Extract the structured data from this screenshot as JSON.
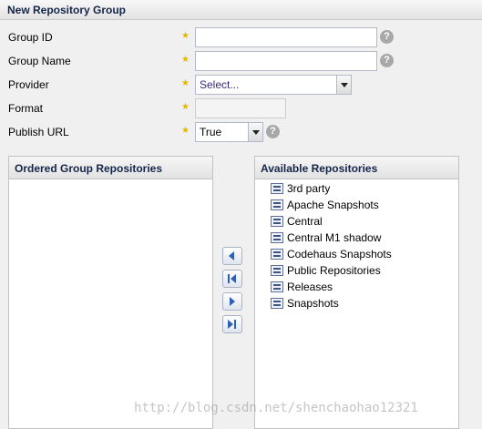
{
  "window": {
    "title": "New Repository Group"
  },
  "form": {
    "group_id": {
      "label": "Group ID",
      "value": ""
    },
    "group_name": {
      "label": "Group Name",
      "value": ""
    },
    "provider": {
      "label": "Provider",
      "placeholder": "Select..."
    },
    "format": {
      "label": "Format",
      "value": ""
    },
    "publish_url": {
      "label": "Publish URL",
      "value": "True"
    },
    "required_marker": "★",
    "help_glyph": "?"
  },
  "ordered_panel": {
    "title": "Ordered Group Repositories",
    "items": []
  },
  "available_panel": {
    "title": "Available Repositories",
    "items": [
      "3rd party",
      "Apache Snapshots",
      "Central",
      "Central M1 shadow",
      "Codehaus Snapshots",
      "Public Repositories",
      "Releases",
      "Snapshots"
    ]
  },
  "move_buttons": [
    {
      "name": "move-left-icon"
    },
    {
      "name": "move-all-left-icon"
    },
    {
      "name": "move-right-icon"
    },
    {
      "name": "move-all-right-icon"
    }
  ],
  "colors": {
    "required": "#e5b800",
    "header_text": "#15264a",
    "help": "#a8a8a8"
  },
  "watermark": "http://blog.csdn.net/shenchaohao12321"
}
